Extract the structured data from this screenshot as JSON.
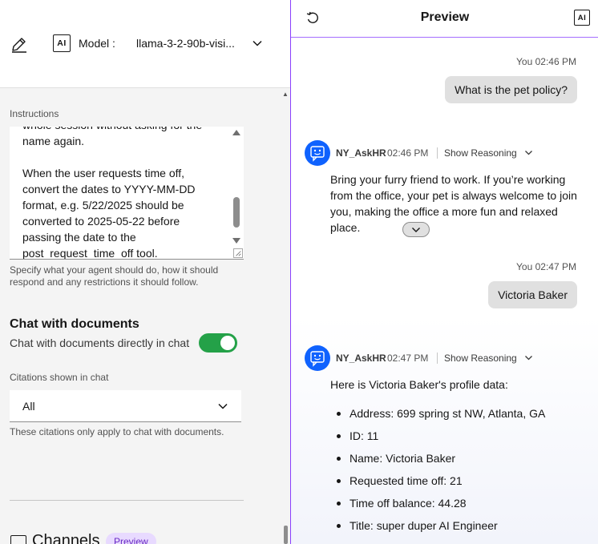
{
  "model": {
    "label": "Model :",
    "value": "llama-3-2-90b-visi...",
    "badge": "AI"
  },
  "instructions": {
    "label": "Instructions",
    "text": "whole session without asking for the name again.\n\nWhen the user requests time off, convert the dates to YYYY-MM-DD format, e.g. 5/22/2025 should be converted to 2025-05-22 before passing the date to the post_request_time_off tool.",
    "helper": "Specify what your agent should do, how it should respond and any restrictions it should follow."
  },
  "chat_with_documents": {
    "title": "Chat with documents",
    "subtitle": "Chat with documents directly in chat",
    "enabled": true
  },
  "citations": {
    "label": "Citations shown in chat",
    "value": "All",
    "helper": "These citations only apply to chat with documents."
  },
  "channels": {
    "title": "Channels",
    "tag": "Preview"
  },
  "preview": {
    "title": "Preview",
    "badge": "AI",
    "messages": [
      {
        "sender": "You",
        "time": "02:46 PM",
        "text": "What is the pet policy?"
      },
      {
        "sender": "NY_AskHR",
        "time": "02:46 PM",
        "reasoning": "Show Reasoning",
        "text": "Bring your furry friend to work. If you’re working from the office, your pet is always welcome to join you, making the office a more fun and relaxed place."
      },
      {
        "sender": "You",
        "time": "02:47 PM",
        "text": "Victoria Baker"
      },
      {
        "sender": "NY_AskHR",
        "time": "02:47 PM",
        "reasoning": "Show Reasoning",
        "text": "Here is Victoria Baker's profile data:",
        "items": [
          "Address: 699 spring st NW, Atlanta, GA",
          "ID: 11",
          "Name: Victoria Baker",
          "Requested time off: 21",
          "Time off balance: 44.28",
          "Title: super duper AI Engineer"
        ]
      }
    ]
  },
  "colors": {
    "accent": "#8a3ffc",
    "toggle_on": "#24a148",
    "avatar": "#0f62fe",
    "tag_bg": "#e8daff"
  },
  "icons": [
    "edit-icon",
    "ai-icon",
    "chevron-down-icon",
    "reset-icon",
    "chatbot-icon",
    "channels-icon"
  ]
}
